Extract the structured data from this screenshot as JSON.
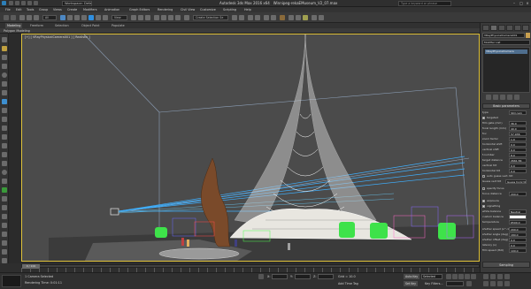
{
  "app": {
    "title": "Autodesk 3ds Max 2016 x64",
    "file": "Winnipeg-rekaEMuseum_V2_07.max",
    "workspace": "Workspace: Default",
    "search_placeholder": "Type a keyword or phrase"
  },
  "menu": [
    "File",
    "Edit",
    "Tools",
    "Group",
    "Views",
    "Create",
    "Modifiers",
    "Animation",
    "Graph Editors",
    "Rendering",
    "Civil View",
    "Customize",
    "Scripting",
    "Help"
  ],
  "toolbar": {
    "selection_filter": "All",
    "view_dropdown": "View",
    "named_selection": "Create Selection Se"
  },
  "ribbon": {
    "tabs": [
      "Modeling",
      "Freeform",
      "Selection",
      "Object Paint",
      "Populate"
    ],
    "active_tab": "Modeling",
    "panel_label": "Polygon Modeling"
  },
  "viewport": {
    "label": "[+] [ VRayPhysicalCamera001 ] [ Realistic ]"
  },
  "command_panel": {
    "object_name": "VRayPhysicalCamera001",
    "modifier_list": "Modifier List",
    "stack_item": "VRayPhysicalCamera",
    "rollout_title": "Basic parameters",
    "params": [
      {
        "label": "type",
        "value": "Still cam"
      },
      {
        "label": "targeted",
        "check": true
      },
      {
        "label": "film gate (mm)",
        "value": "36.0"
      },
      {
        "label": "focal length (mm)",
        "value": "40.0"
      },
      {
        "label": "fov",
        "value": "57.936"
      },
      {
        "label": "zoom factor",
        "value": "1.0"
      },
      {
        "label": "horizontal shift",
        "value": "0.0"
      },
      {
        "label": "vertical shift",
        "value": "0.0"
      },
      {
        "label": "f-number",
        "value": "8.0"
      },
      {
        "label": "target distance",
        "value": "2661.56"
      },
      {
        "label": "vertical tilt",
        "value": "0.0"
      },
      {
        "label": "horizontal tilt",
        "value": "0.0"
      },
      {
        "label": "auto guess vert. tilt",
        "check": false
      },
      {
        "label": "Guess vert tilt",
        "value": "Guess horiz tilt"
      },
      {
        "label": "specify focus",
        "check": false
      },
      {
        "label": "focus distance",
        "value": "200.0"
      },
      {
        "label": "exposure",
        "check": true
      },
      {
        "label": "vignetting",
        "check": true
      },
      {
        "label": "white balance",
        "value": "Neutral"
      },
      {
        "label": "custom balance",
        "value": ""
      },
      {
        "label": "temperature",
        "value": "6500.0"
      },
      {
        "label": "shutter speed (s^-1)",
        "value": "200.0"
      },
      {
        "label": "shutter angle (deg)",
        "value": "180.0"
      },
      {
        "label": "shutter offset (deg)",
        "value": "0.0"
      },
      {
        "label": "latency (s)",
        "value": "0.0"
      },
      {
        "label": "film speed (ISO)",
        "value": "100.0"
      }
    ],
    "bottom_button": "Sampling"
  },
  "timeline": {
    "position": "0 / 100"
  },
  "status": {
    "selected": "1 Camera Selected",
    "prompt": "Rendering Time: 0:01:11",
    "x_label": "X:",
    "y_label": "Y:",
    "z_label": "Z:",
    "grid": "Grid = 10.0",
    "add_time_tag": "Add Time Tag",
    "auto_key": "Auto Key",
    "selected_dropdown": "Selected",
    "set_key": "Set Key",
    "key_filters": "Key Filters..."
  },
  "colors": {
    "viewport_bg": "#4b4b4b",
    "active_border": "#e0c23a",
    "camera_lines": "#3fb0ff",
    "tower": "#e8e6e0",
    "trees": "#3ee24a"
  }
}
